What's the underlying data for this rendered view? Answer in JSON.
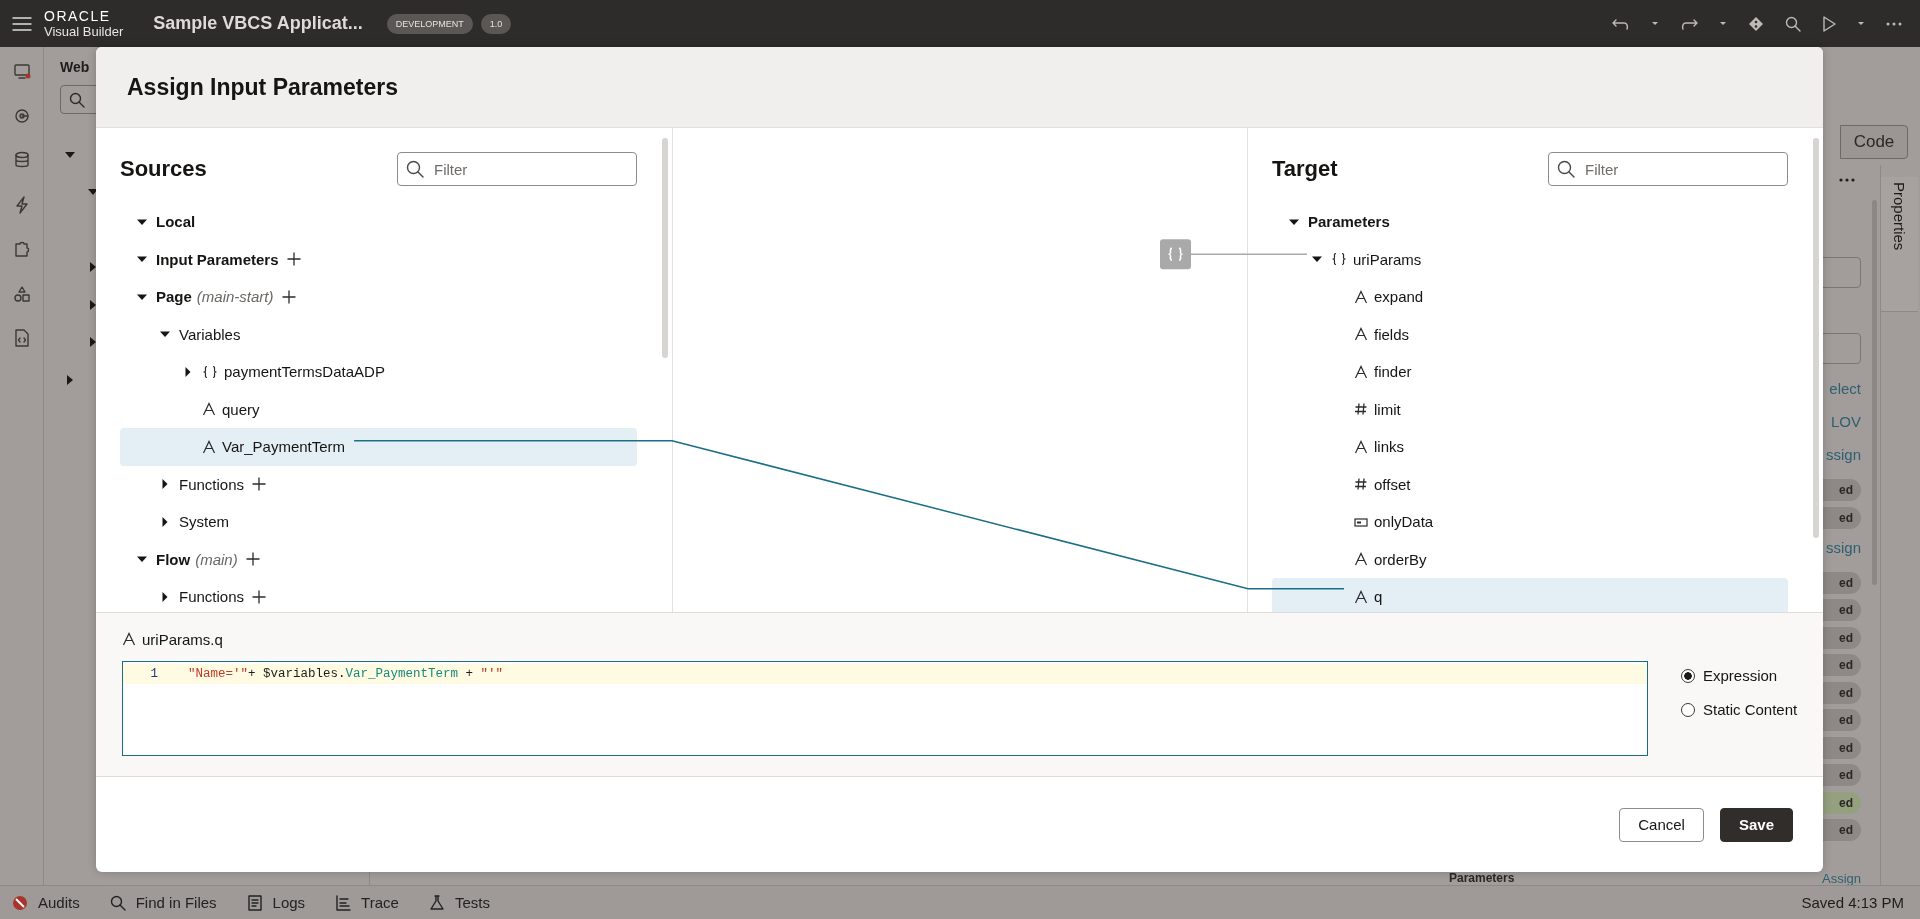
{
  "top_bar": {
    "brand": "ORACLE",
    "product": "Visual Builder",
    "application": "Sample VBCS Applicat...",
    "badges": [
      "DEVELOPMENT",
      "1.0"
    ]
  },
  "navigator": {
    "title": "Web",
    "tree": [
      {
        "expanded": true,
        "children": [
          {
            "expanded": true
          },
          {
            "expanded": false
          },
          {
            "expanded": false
          },
          {
            "expanded": false
          }
        ]
      },
      {
        "expanded": false
      }
    ]
  },
  "editor_toolbar": {
    "code_tab": "Code"
  },
  "properties_panel": {
    "side_tab": "Properties",
    "fragments": [
      {
        "kind": "field"
      },
      {
        "kind": "field"
      },
      {
        "kind": "link",
        "text": "elect"
      },
      {
        "kind": "link",
        "text": "LOV"
      },
      {
        "kind": "link",
        "text": "ssign"
      },
      {
        "kind": "badge",
        "text": "ed",
        "color": "#8e8986"
      },
      {
        "kind": "badge",
        "text": "ed",
        "color": "#8e8986"
      },
      {
        "kind": "link",
        "text": "ssign"
      },
      {
        "kind": "badge",
        "text": "ed",
        "color": "#8e8986"
      },
      {
        "kind": "badge",
        "text": "ed",
        "color": "#8e8986"
      },
      {
        "kind": "badge",
        "text": "ed",
        "color": "#8e8986"
      },
      {
        "kind": "badge",
        "text": "ed",
        "color": "#8e8986"
      },
      {
        "kind": "badge",
        "text": "ed",
        "color": "#8e8986"
      },
      {
        "kind": "badge",
        "text": "ed",
        "color": "#8e8986"
      },
      {
        "kind": "badge",
        "text": "ed",
        "color": "#8e8986"
      },
      {
        "kind": "badge",
        "text": "ed",
        "color": "#8e8986"
      },
      {
        "kind": "badge",
        "text": "ed",
        "color": "#94a07e"
      },
      {
        "kind": "badge",
        "text": "ed",
        "color": "#8e8986"
      }
    ],
    "section_label": "Parameters",
    "section_link": "Assign"
  },
  "dialog": {
    "title": "Assign Input Parameters",
    "sources": {
      "title": "Sources",
      "filter_placeholder": "Filter",
      "tree": [
        {
          "label": "Local",
          "expanded": true
        },
        {
          "label": "Input Parameters",
          "expanded": true,
          "addable": true
        },
        {
          "label": "Page",
          "note": "(main-start)",
          "expanded": true,
          "addable": true,
          "children": [
            {
              "label": "Variables",
              "expanded": true,
              "children": [
                {
                  "label": "paymentTermsDataADP",
                  "kind": "object",
                  "expanded": false,
                  "selected": false
                },
                {
                  "label": "query",
                  "kind": "string",
                  "selected": false
                },
                {
                  "label": "Var_PaymentTerm",
                  "kind": "string",
                  "selected": true
                }
              ]
            },
            {
              "label": "Functions",
              "expanded": false,
              "addable": true
            },
            {
              "label": "System",
              "expanded": false
            }
          ]
        },
        {
          "label": "Flow",
          "note": "(main)",
          "expanded": true,
          "addable": true,
          "children": [
            {
              "label": "Functions",
              "expanded": false,
              "addable": true
            }
          ]
        }
      ]
    },
    "target": {
      "title": "Target",
      "filter_placeholder": "Filter",
      "tree": [
        {
          "label": "Parameters",
          "expanded": true,
          "children": [
            {
              "label": "uriParams",
              "kind": "object",
              "expanded": true,
              "object_mapped": true,
              "selected": false,
              "children": [
                {
                  "label": "expand",
                  "kind": "string",
                  "selected": false
                },
                {
                  "label": "fields",
                  "kind": "string",
                  "selected": false
                },
                {
                  "label": "finder",
                  "kind": "string",
                  "selected": false
                },
                {
                  "label": "limit",
                  "kind": "number",
                  "selected": false
                },
                {
                  "label": "links",
                  "kind": "string",
                  "selected": false
                },
                {
                  "label": "offset",
                  "kind": "number",
                  "selected": false
                },
                {
                  "label": "onlyData",
                  "kind": "boolean",
                  "selected": false
                },
                {
                  "label": "orderBy",
                  "kind": "string",
                  "selected": false
                },
                {
                  "label": "q",
                  "kind": "string",
                  "selected": true
                }
              ]
            }
          ]
        }
      ]
    },
    "expression": {
      "path": "uriParams.q",
      "kind": "string",
      "line_number": "1",
      "tokens": [
        {
          "kind": "string",
          "text": "\"Name='\""
        },
        {
          "kind": "plain",
          "text": "+ $variables."
        },
        {
          "kind": "property",
          "text": "Var_PaymentTerm"
        },
        {
          "kind": "plain",
          "text": " + "
        },
        {
          "kind": "string",
          "text": "\"'\""
        }
      ],
      "modes": [
        {
          "label": "Expression",
          "selected": true
        },
        {
          "label": "Static Content",
          "selected": false
        }
      ]
    },
    "buttons": [
      {
        "label": "Cancel",
        "kind": "secondary"
      },
      {
        "label": "Save",
        "kind": "primary"
      }
    ]
  },
  "status_bar": {
    "items": [
      {
        "label": "Audits"
      },
      {
        "label": "Find in Files"
      },
      {
        "label": "Logs"
      },
      {
        "label": "Trace"
      },
      {
        "label": "Tests"
      }
    ],
    "saved": "Saved 4:13 PM"
  }
}
